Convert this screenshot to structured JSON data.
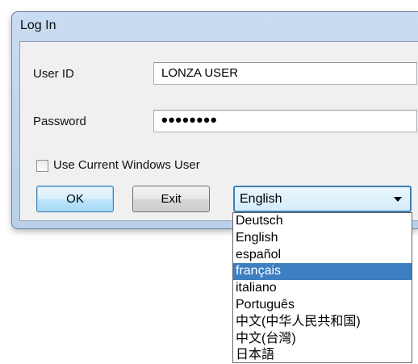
{
  "dialog": {
    "title": "Log In",
    "user_id_label": "User ID",
    "user_id_value": "LONZA USER",
    "password_label": "Password",
    "password_value": "••••••••",
    "use_windows_user_label": "Use Current Windows User",
    "use_windows_user_checked": false,
    "ok_label": "OK",
    "exit_label": "Exit"
  },
  "language": {
    "selected": "English",
    "highlighted": "français",
    "options": [
      "Deutsch",
      "English",
      "español",
      "français",
      "italiano",
      "Português",
      "中文(中华人民共和国)",
      "中文(台灣)",
      "日本語"
    ]
  },
  "colors": {
    "highlight": "#3d7fc1",
    "focus_border": "#3c7fb1",
    "title_bar": "#c9dcf1"
  }
}
